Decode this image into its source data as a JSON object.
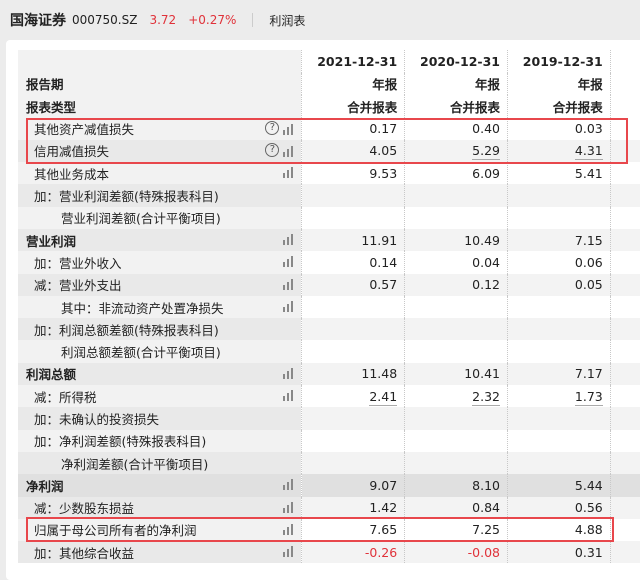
{
  "header": {
    "name": "国海证券",
    "code": "000750.SZ",
    "price": "3.72",
    "change": "+0.27%",
    "sheet": "利润表"
  },
  "columns": [
    {
      "date": "2021-12-31",
      "type": "年报",
      "scope": "合并报表"
    },
    {
      "date": "2020-12-31",
      "type": "年报",
      "scope": "合并报表"
    },
    {
      "date": "2019-12-31",
      "type": "年报",
      "scope": "合并报表"
    }
  ],
  "row_labels": {
    "period": "报告期",
    "report_type": "报表类型"
  },
  "rows": [
    {
      "label": "其他资产减值损失",
      "values": [
        "0.17",
        "0.40",
        "0.03"
      ],
      "help": true,
      "chart": true,
      "highlight": true
    },
    {
      "label": "信用减值损失",
      "values": [
        "4.05",
        "5.29",
        "4.31"
      ],
      "help": true,
      "chart": true,
      "highlight": true
    },
    {
      "label": "其他业务成本",
      "values": [
        "9.53",
        "6.09",
        "5.41"
      ],
      "chart": true
    },
    {
      "label": "加：营业利润差额(特殊报表科目)",
      "values": [
        "",
        "",
        ""
      ]
    },
    {
      "label": "营业利润差额(合计平衡项目)",
      "values": [
        "",
        "",
        ""
      ]
    },
    {
      "label": "营业利润",
      "values": [
        "11.91",
        "10.49",
        "7.15"
      ],
      "chart": true,
      "bold": true
    },
    {
      "label": "加：营业外收入",
      "values": [
        "0.14",
        "0.04",
        "0.06"
      ],
      "chart": true
    },
    {
      "label": "减：营业外支出",
      "values": [
        "0.57",
        "0.12",
        "0.05"
      ],
      "chart": true
    },
    {
      "label": "其中：非流动资产处置净损失",
      "values": [
        "",
        "",
        ""
      ],
      "chart": true
    },
    {
      "label": "加：利润总额差额(特殊报表科目)",
      "values": [
        "",
        "",
        ""
      ]
    },
    {
      "label": "利润总额差额(合计平衡项目)",
      "values": [
        "",
        "",
        ""
      ]
    },
    {
      "label": "利润总额",
      "values": [
        "11.48",
        "10.41",
        "7.17"
      ],
      "chart": true,
      "bold": true
    },
    {
      "label": "减：所得税",
      "values": [
        "2.41",
        "2.32",
        "1.73"
      ],
      "chart": true
    },
    {
      "label": "加：未确认的投资损失",
      "values": [
        "",
        "",
        ""
      ]
    },
    {
      "label": "加：净利润差额(特殊报表科目)",
      "values": [
        "",
        "",
        ""
      ]
    },
    {
      "label": "净利润差额(合计平衡项目)",
      "values": [
        "",
        "",
        ""
      ]
    },
    {
      "label": "净利润",
      "values": [
        "9.07",
        "8.10",
        "5.44"
      ],
      "chart": true,
      "bold": true
    },
    {
      "label": "减：少数股东损益",
      "values": [
        "1.42",
        "0.84",
        "0.56"
      ],
      "chart": true
    },
    {
      "label": "归属于母公司所有者的净利润",
      "values": [
        "7.65",
        "7.25",
        "4.88"
      ],
      "chart": true,
      "highlight": true
    },
    {
      "label": "加：其他综合收益",
      "values": [
        "-0.26",
        "-0.08",
        "0.31"
      ],
      "chart": true
    }
  ],
  "colors": {
    "negative": "#e0323a",
    "highlight_box": "#e8474c"
  }
}
